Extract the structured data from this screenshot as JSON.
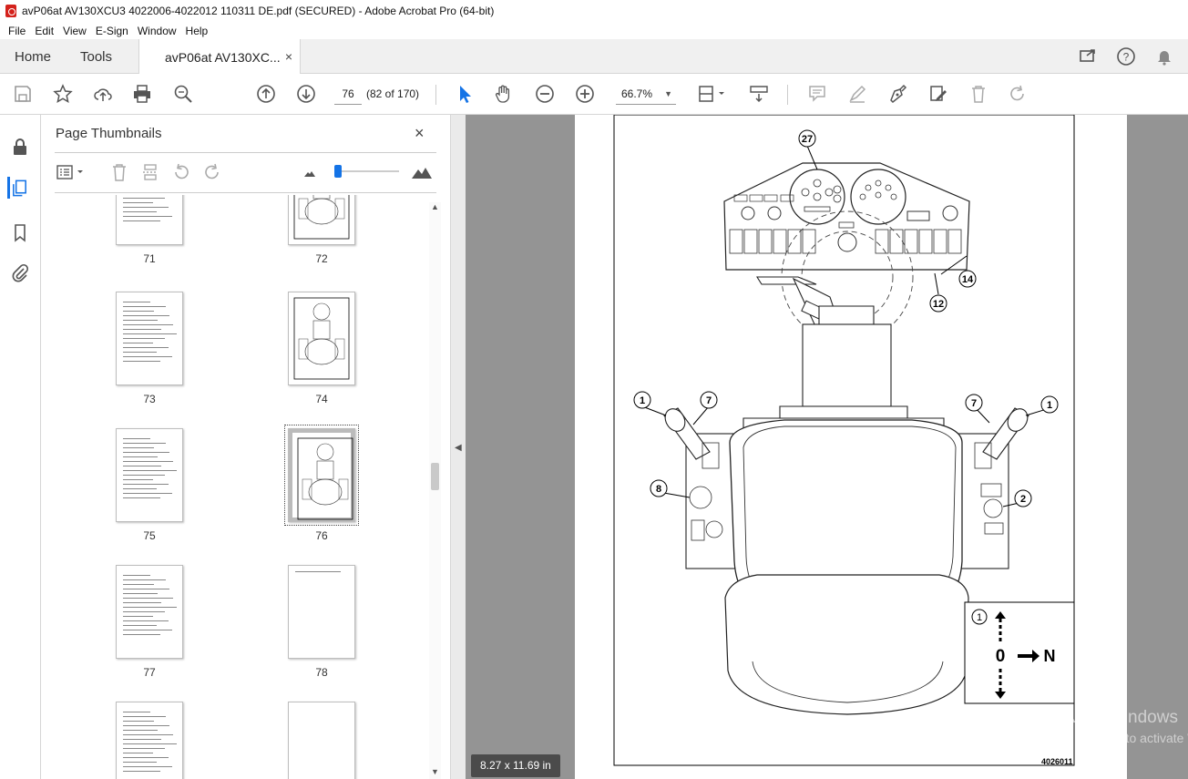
{
  "window": {
    "title": "avP06at AV130XCU3 4022006-4022012 110311 DE.pdf (SECURED) - Adobe Acrobat Pro (64-bit)"
  },
  "menu": [
    "File",
    "Edit",
    "View",
    "E-Sign",
    "Window",
    "Help"
  ],
  "tabs": {
    "home": "Home",
    "tools": "Tools",
    "document": "avP06at AV130XC...",
    "close": "×"
  },
  "toolbar": {
    "page_number": "76",
    "page_count": "(82 of 170)",
    "zoom": "66.7%"
  },
  "panel": {
    "title": "Page Thumbnails",
    "close": "×",
    "thumbnails": [
      {
        "label": "71"
      },
      {
        "label": "72"
      },
      {
        "label": "73"
      },
      {
        "label": "74"
      },
      {
        "label": "75"
      },
      {
        "label": "76",
        "selected": true
      },
      {
        "label": "77"
      },
      {
        "label": "78"
      },
      {
        "label": ""
      },
      {
        "label": ""
      }
    ]
  },
  "document_page": {
    "callouts": [
      "27",
      "14",
      "12",
      "1",
      "7",
      "7",
      "1",
      "8",
      "2"
    ],
    "legend": {
      "number": "1",
      "zero": "0",
      "neutral": "N"
    },
    "figure_id": "4026011"
  },
  "status": {
    "page_size": "8.27 x 11.69 in"
  },
  "watermark": {
    "line1": "Activate Windows",
    "line2": "Go to Settings to activate Windows."
  },
  "colors": {
    "accent": "#1473e6",
    "pdf_red": "#d4221c",
    "viewer_bg": "#949494"
  }
}
